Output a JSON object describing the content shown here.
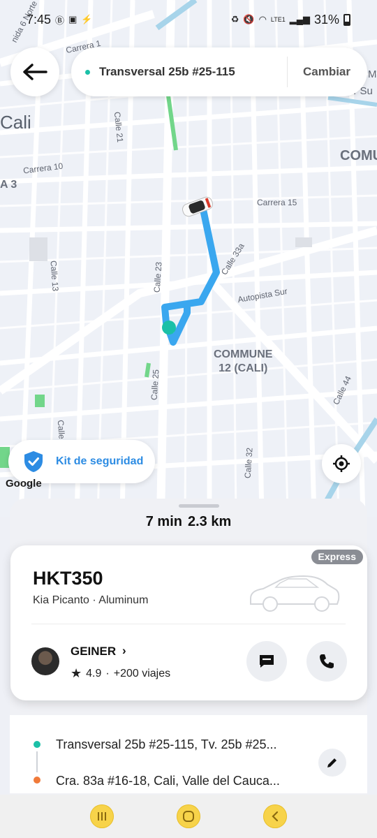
{
  "status_bar": {
    "time": "7:45",
    "battery": "31%",
    "left_icons": [
      "b-circle-icon",
      "app-icon",
      "bolt-icon"
    ],
    "right_icons": [
      "battery-saver-icon",
      "mute-icon",
      "wifi-icon",
      "volte-icon",
      "signal-icon"
    ]
  },
  "header": {
    "destination": "Transversal 25b #25-115",
    "change_label": "Cambiar"
  },
  "map": {
    "labels": {
      "avenida_6_norte": "nida 6 Norte",
      "carrera_1": "Carrera 1",
      "city": "Cali",
      "calle_21": "Calle 21",
      "carrera_10": "Carrera 10",
      "a3": "A 3",
      "comm_edge": "COMU",
      "carrera_15": "Carrera 15",
      "calle_33a": "Calle 33a",
      "calle_13": "Calle 13",
      "calle_23": "Calle 23",
      "autopista_sur": "Autopista Sur",
      "commune": "COMMUNE\n12 (CALI)",
      "calle_25": "Calle 25",
      "calle_44": "Calle 44",
      "calle": "Calle",
      "calle_32": "Calle 32",
      "edge_m": "M",
      "edge_sur": "er Su"
    },
    "logo": "Google",
    "route_color": "#3aa7ef",
    "pickup_color": "#1bc0a7"
  },
  "safety": {
    "label": "Kit de seguridad"
  },
  "trip": {
    "eta_minutes": "7 min",
    "distance": "2.3 km"
  },
  "vehicle": {
    "service": "Express",
    "plate": "HKT350",
    "model": "Kia Picanto · Aluminum"
  },
  "driver": {
    "name": "GEINER",
    "rating": "4.9",
    "trips": "+200 viajes",
    "separator": "·"
  },
  "route": {
    "pickup": "Transversal 25b #25-115, Tv. 25b #25...",
    "dropoff": "Cra. 83a #16-18, Cali, Valle del Cauca...",
    "pickup_color": "#1bc0a7",
    "dropoff_color": "#f07a3a"
  }
}
